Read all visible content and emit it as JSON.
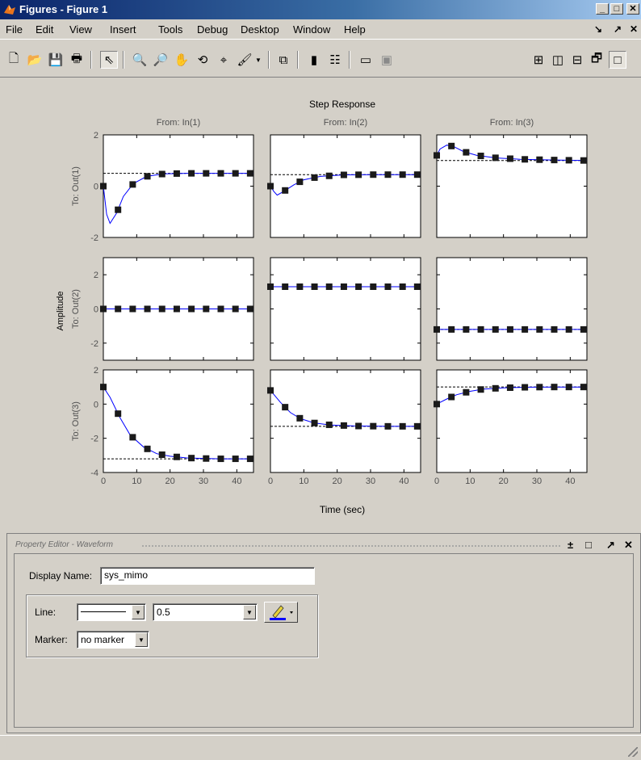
{
  "window": {
    "title": "Figures - Figure 1"
  },
  "menu": {
    "items": [
      "File",
      "Edit",
      "View",
      "Insert",
      "Tools",
      "Debug",
      "Desktop",
      "Window",
      "Help"
    ],
    "right": [
      "↘",
      "↗",
      "✕"
    ]
  },
  "toolbar": {
    "buttons": [
      {
        "name": "new-figure-icon",
        "glyph": "🗋"
      },
      {
        "name": "open-icon",
        "glyph": "📂"
      },
      {
        "name": "save-icon",
        "glyph": "💾"
      },
      {
        "name": "print-icon",
        "glyph": "🖶"
      },
      {
        "name": "arrow-pointer-icon",
        "glyph": "⇖"
      },
      {
        "name": "zoom-in-icon",
        "glyph": "🔍"
      },
      {
        "name": "zoom-out-icon",
        "glyph": "🔎"
      },
      {
        "name": "pan-hand-icon",
        "glyph": "✋"
      },
      {
        "name": "rotate-3d-icon",
        "glyph": "⟲"
      },
      {
        "name": "data-cursor-icon",
        "glyph": "⌖"
      },
      {
        "name": "brush-icon",
        "glyph": "🖌"
      },
      {
        "name": "link-plot-icon",
        "glyph": "⧉"
      },
      {
        "name": "colorbar-icon",
        "glyph": "▮"
      },
      {
        "name": "legend-icon",
        "glyph": "☷"
      },
      {
        "name": "hide-plot-tools-icon",
        "glyph": "▭"
      },
      {
        "name": "show-plot-tools-icon",
        "glyph": "▣"
      },
      {
        "name": "tile-grid-icon",
        "glyph": "⊞"
      },
      {
        "name": "tile-columns-icon",
        "glyph": "◫"
      },
      {
        "name": "tile-rows-icon",
        "glyph": "⊟"
      },
      {
        "name": "float-icon",
        "glyph": "🗗"
      },
      {
        "name": "maximize-icon",
        "glyph": "□"
      }
    ]
  },
  "chart_data": {
    "type": "line",
    "title": "Step Response",
    "xlabel": "Time (sec)",
    "ylabel": "Amplitude",
    "column_labels": [
      "From: In(1)",
      "From: In(2)",
      "From: In(3)"
    ],
    "row_labels": [
      "To: Out(1)",
      "To: Out(2)",
      "To: Out(3)"
    ],
    "xlim": [
      0,
      45
    ],
    "xticks": [
      "0",
      "10",
      "20",
      "30",
      "40"
    ],
    "rows": [
      {
        "ylim": [
          -2,
          2
        ],
        "yticks": [
          "-2",
          "0",
          "2"
        ]
      },
      {
        "ylim": [
          -3,
          3
        ],
        "yticks": [
          "-2",
          "0",
          "2"
        ]
      },
      {
        "ylim": [
          -4,
          2
        ],
        "yticks": [
          "-4",
          "-2",
          "0",
          "2"
        ]
      }
    ],
    "series": [
      {
        "row": 0,
        "col": 0,
        "final": 0.5,
        "x": [
          0,
          1,
          2,
          4,
          6,
          9,
          13,
          18,
          25,
          35,
          45
        ],
        "y": [
          0,
          -1.1,
          -1.45,
          -1.05,
          -0.4,
          0.1,
          0.38,
          0.48,
          0.5,
          0.5,
          0.5
        ]
      },
      {
        "row": 0,
        "col": 1,
        "final": 0.45,
        "x": [
          0,
          1,
          2,
          4,
          7,
          10,
          15,
          22,
          30,
          45
        ],
        "y": [
          0,
          -0.2,
          -0.35,
          -0.2,
          0.05,
          0.25,
          0.38,
          0.44,
          0.45,
          0.45
        ]
      },
      {
        "row": 0,
        "col": 2,
        "final": 1.0,
        "x": [
          0,
          1,
          3,
          5,
          8,
          12,
          18,
          25,
          35,
          45
        ],
        "y": [
          1.2,
          1.45,
          1.6,
          1.55,
          1.35,
          1.2,
          1.1,
          1.05,
          1.02,
          1.0
        ]
      },
      {
        "row": 1,
        "col": 0,
        "final": 0.0,
        "x": [
          0,
          45
        ],
        "y": [
          0,
          0
        ]
      },
      {
        "row": 1,
        "col": 1,
        "final": 1.3,
        "x": [
          0,
          45
        ],
        "y": [
          1.3,
          1.3
        ]
      },
      {
        "row": 1,
        "col": 2,
        "final": -1.2,
        "x": [
          0,
          45
        ],
        "y": [
          -1.2,
          -1.2
        ]
      },
      {
        "row": 2,
        "col": 0,
        "final": -3.2,
        "x": [
          0,
          2,
          5,
          8,
          12,
          16,
          20,
          25,
          30,
          35,
          45
        ],
        "y": [
          1.0,
          0.4,
          -0.8,
          -1.8,
          -2.5,
          -2.9,
          -3.05,
          -3.15,
          -3.18,
          -3.2,
          -3.2
        ]
      },
      {
        "row": 2,
        "col": 1,
        "final": -1.3,
        "x": [
          0,
          3,
          6,
          9,
          13,
          18,
          25,
          35,
          45
        ],
        "y": [
          0.8,
          0.1,
          -0.5,
          -0.85,
          -1.1,
          -1.22,
          -1.28,
          -1.3,
          -1.3
        ]
      },
      {
        "row": 2,
        "col": 2,
        "final": 1.0,
        "x": [
          0,
          3,
          6,
          10,
          14,
          20,
          28,
          36,
          45
        ],
        "y": [
          0.0,
          0.3,
          0.55,
          0.75,
          0.88,
          0.95,
          0.99,
          1.0,
          1.0
        ]
      }
    ]
  },
  "property_editor": {
    "title": "Property Editor - Waveform",
    "controls": [
      "±",
      "□",
      "↗",
      "✕"
    ],
    "display_name_label": "Display Name:",
    "display_name_value": "sys_mimo",
    "line_label": "Line:",
    "line_width_value": "0.5",
    "marker_label": "Marker:",
    "marker_value": "no marker",
    "line_color": "#0000ff"
  }
}
